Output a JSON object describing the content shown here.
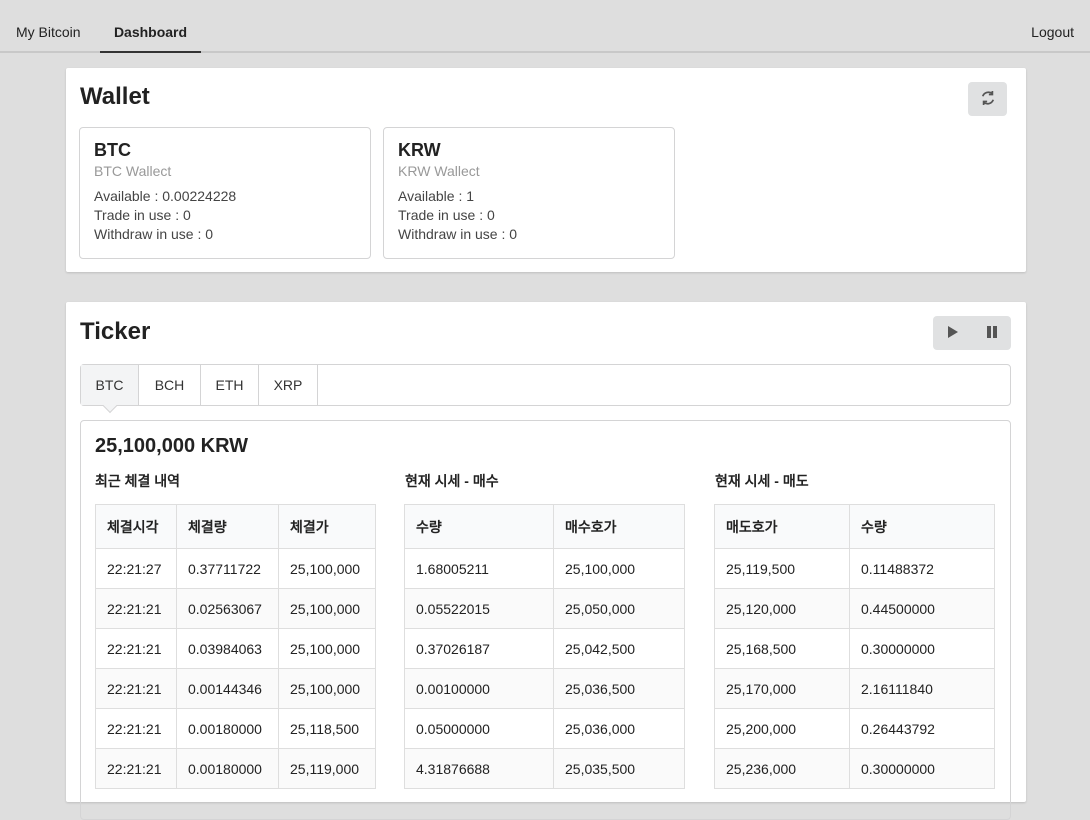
{
  "nav": {
    "brand": "My Bitcoin",
    "dashboard": "Dashboard",
    "logout": "Logout"
  },
  "wallet": {
    "title": "Wallet",
    "refresh_icon": "refresh-icon",
    "btc": {
      "name": "BTC",
      "subtitle": "BTC Wallect",
      "available": "Available : 0.00224228",
      "trade": "Trade in use : 0",
      "withdraw": "Withdraw in use : 0"
    },
    "krw": {
      "name": "KRW",
      "subtitle": "KRW Wallect",
      "available": "Available : 1",
      "trade": "Trade in use : 0",
      "withdraw": "Withdraw in use : 0"
    }
  },
  "ticker": {
    "title": "Ticker",
    "tabs": [
      "BTC",
      "BCH",
      "ETH",
      "XRP"
    ],
    "active_tab": "BTC",
    "price": "25,100,000 KRW",
    "recent": {
      "title": "최근 체결 내역",
      "headers": [
        "체결시각",
        "체결량",
        "체결가"
      ],
      "rows": [
        [
          "22:21:27",
          "0.37711722",
          "25,100,000"
        ],
        [
          "22:21:21",
          "0.02563067",
          "25,100,000"
        ],
        [
          "22:21:21",
          "0.03984063",
          "25,100,000"
        ],
        [
          "22:21:21",
          "0.00144346",
          "25,100,000"
        ],
        [
          "22:21:21",
          "0.00180000",
          "25,118,500"
        ],
        [
          "22:21:21",
          "0.00180000",
          "25,119,000"
        ]
      ]
    },
    "bids": {
      "title": "현재 시세 - 매수",
      "headers": [
        "수량",
        "매수호가"
      ],
      "rows": [
        [
          "1.68005211",
          "25,100,000"
        ],
        [
          "0.05522015",
          "25,050,000"
        ],
        [
          "0.37026187",
          "25,042,500"
        ],
        [
          "0.00100000",
          "25,036,500"
        ],
        [
          "0.05000000",
          "25,036,000"
        ],
        [
          "4.31876688",
          "25,035,500"
        ]
      ]
    },
    "asks": {
      "title": "현재 시세 - 매도",
      "headers": [
        "매도호가",
        "수량"
      ],
      "rows": [
        [
          "25,119,500",
          "0.11488372"
        ],
        [
          "25,120,000",
          "0.44500000"
        ],
        [
          "25,168,500",
          "0.30000000"
        ],
        [
          "25,170,000",
          "2.16111840"
        ],
        [
          "25,200,000",
          "0.26443792"
        ],
        [
          "25,236,000",
          "0.30000000"
        ]
      ]
    }
  }
}
